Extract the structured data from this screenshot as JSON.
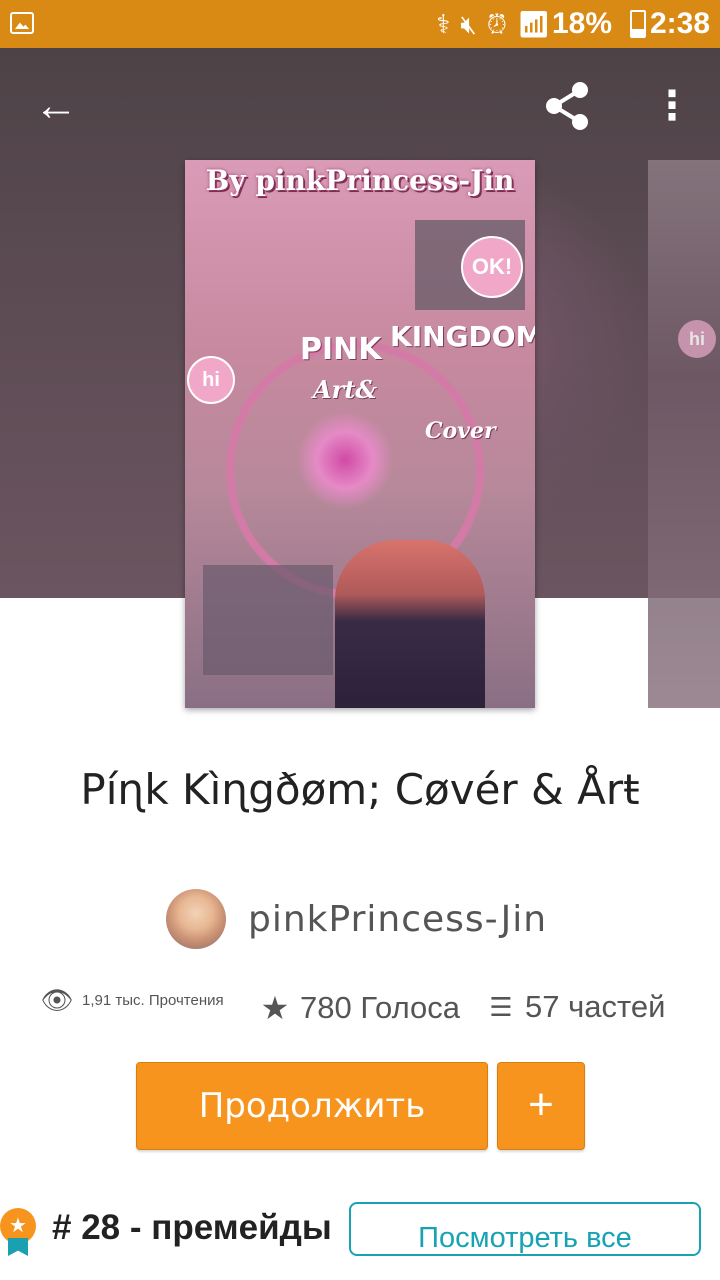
{
  "status_bar": {
    "battery_level": "18%",
    "time": "2:38",
    "icons": [
      "image-icon",
      "usb-icon",
      "mute-icon",
      "alarm-icon",
      "wifi-icon",
      "signal-icon",
      "battery-charging-icon"
    ]
  },
  "toolbar": {
    "back_icon": "arrow-left-icon",
    "share_icon": "share-icon",
    "more_icon": "more-vertical-icon"
  },
  "cover": {
    "title_text": "By pinkPrincess-Jin",
    "word_pink": "PINK",
    "word_kingdom": "KINGDOM",
    "word_art": "Art&",
    "word_cover": "Cover",
    "bubble_ok": "OK!",
    "bubble_hi": "hi"
  },
  "story": {
    "title": "Píɳk Kìɳgðøm; Cøvér & Årŧ",
    "author": "pinkPrincess-Jin"
  },
  "stats": {
    "reads": "1,91 тыс. Прочтения",
    "votes": "780 Голоса",
    "parts": "57 частей"
  },
  "actions": {
    "continue_label": "Продолжить",
    "add_label": "+"
  },
  "ranking": {
    "text": "# 28 - премейды",
    "see_all_label": "Посмотреть все"
  },
  "colors": {
    "status_bar": "#d98a14",
    "accent_orange": "#f7941d",
    "accent_teal": "#17a3b4"
  }
}
